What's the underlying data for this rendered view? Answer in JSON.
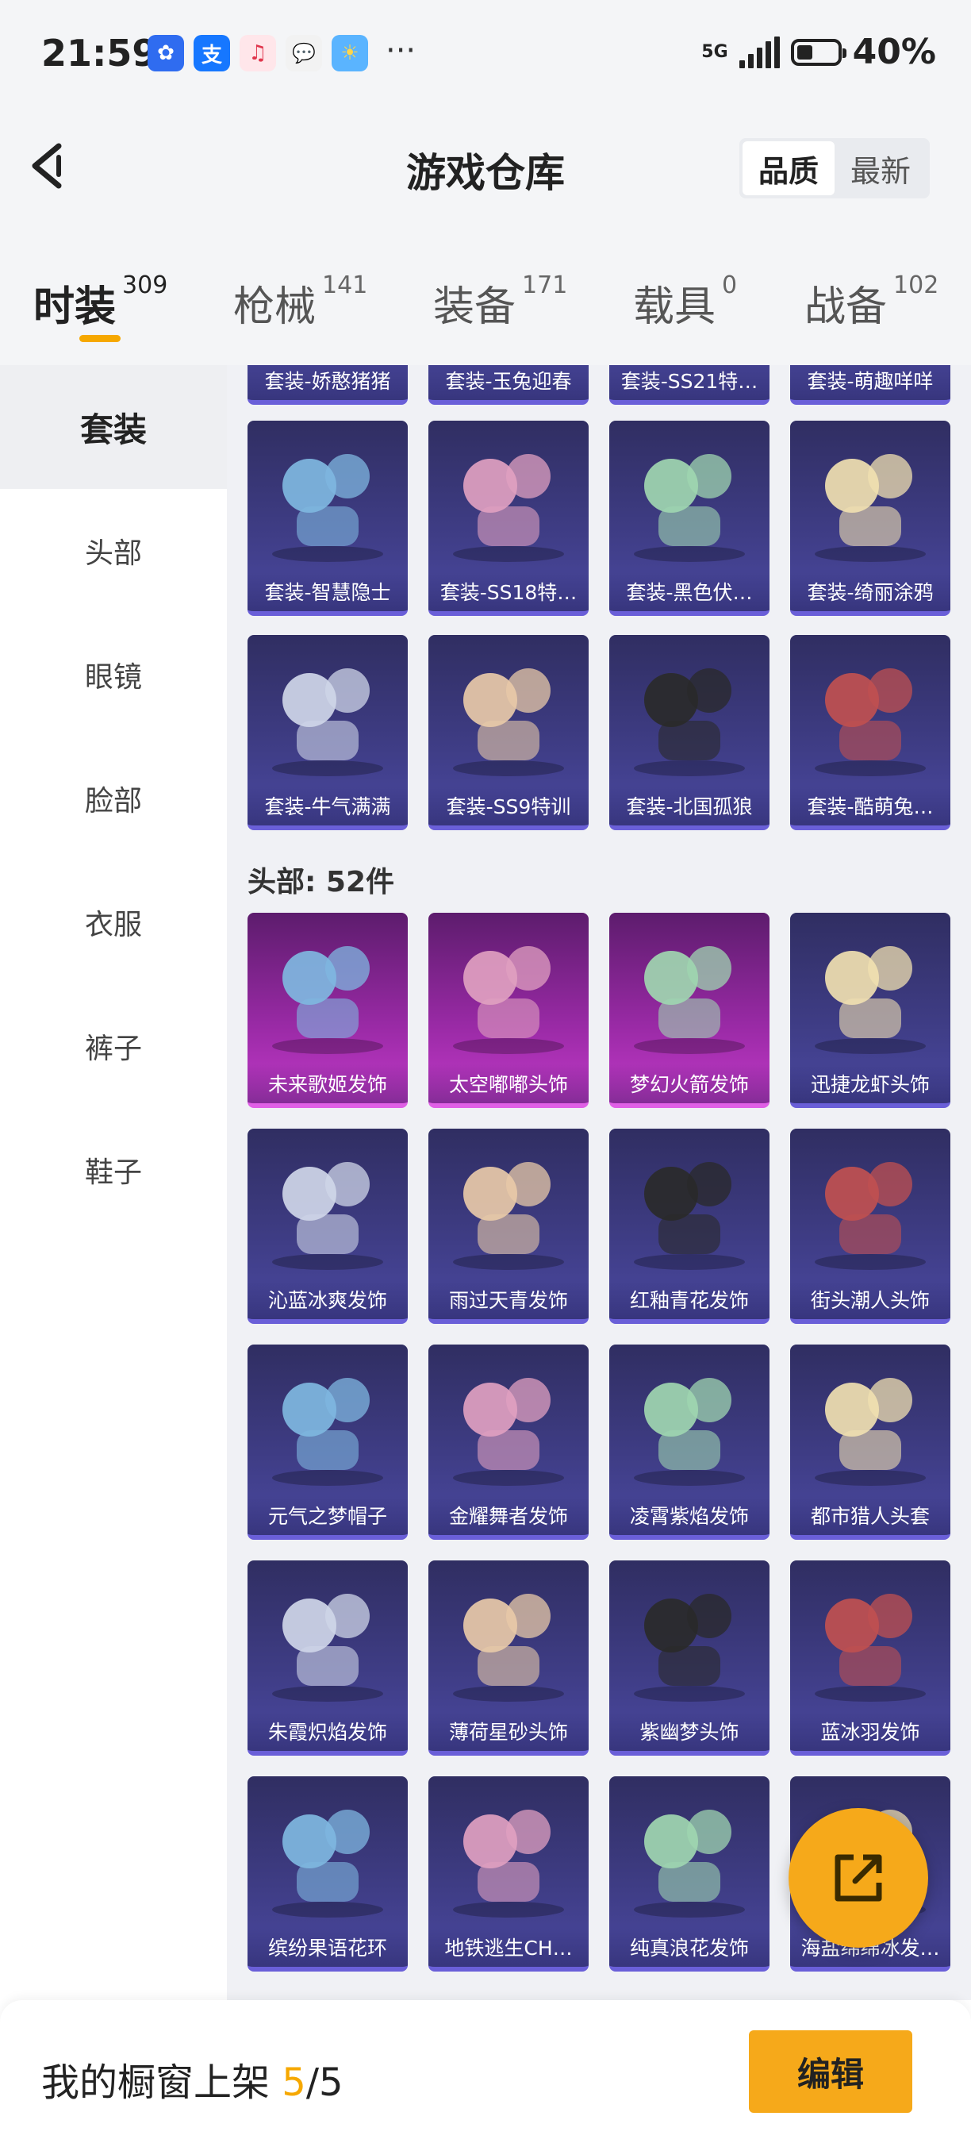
{
  "status_bar": {
    "time": "21:59",
    "apps": [
      {
        "icon": "game-center-icon",
        "color": "#2f6cf0",
        "glyph": "✿"
      },
      {
        "icon": "alipay-icon",
        "color": "#1677ff",
        "glyph": "支"
      },
      {
        "icon": "music-icon",
        "color": "#ffe6ea",
        "glyph": "♫"
      },
      {
        "icon": "wechat-icon",
        "color": "#f2f2f2",
        "glyph": "💬"
      },
      {
        "icon": "weather-icon",
        "color": "#5ab4ff",
        "glyph": "☀"
      }
    ],
    "more": "···",
    "network": "5G",
    "battery_level": 0.4,
    "battery_text": "40%"
  },
  "header": {
    "title": "游戏仓库",
    "sort_options": [
      {
        "label": "品质",
        "active": true
      },
      {
        "label": "最新",
        "active": false
      }
    ]
  },
  "category_tabs": [
    {
      "label": "时装",
      "count": "309",
      "active": true
    },
    {
      "label": "枪械",
      "count": "141",
      "active": false
    },
    {
      "label": "装备",
      "count": "171",
      "active": false
    },
    {
      "label": "载具",
      "count": "0",
      "active": false
    },
    {
      "label": "战备",
      "count": "102",
      "active": false
    }
  ],
  "sidebar": {
    "items": [
      {
        "label": "套装",
        "active": true
      },
      {
        "label": "头部",
        "active": false
      },
      {
        "label": "眼镜",
        "active": false
      },
      {
        "label": "脸部",
        "active": false
      },
      {
        "label": "衣服",
        "active": false
      },
      {
        "label": "裤子",
        "active": false
      },
      {
        "label": "鞋子",
        "active": false
      }
    ]
  },
  "suits": {
    "partial_row": [
      "套装-娇憨猪猪",
      "套装-玉兔迎春",
      "套装-SS21特…",
      "套装-萌趣咩咩"
    ],
    "rows": [
      [
        "套装-智慧隐士",
        "套装-SS18特…",
        "套装-黑色伏…",
        "套装-绮丽涂鸦"
      ],
      [
        "套装-牛气满满",
        "套装-SS9特训",
        "套装-北国孤狼",
        "套装-酷萌兔…"
      ]
    ]
  },
  "head_section": {
    "label": "头部: 52件",
    "rows": [
      [
        "未来歌姬发饰",
        "太空嘟嘟头饰",
        "梦幻火箭发饰",
        "迅捷龙虾头饰"
      ],
      [
        "沁蓝冰爽发饰",
        "雨过天青发饰",
        "红釉青花发饰",
        "街头潮人头饰"
      ],
      [
        "元气之梦帽子",
        "金耀舞者发饰",
        "凌霄紫焰发饰",
        "都市猎人头套"
      ],
      [
        "朱霞炽焰发饰",
        "薄荷星砂头饰",
        "紫幽梦头饰",
        "蓝冰羽发饰"
      ],
      [
        "缤纷果语花环",
        "地铁逃生CH…",
        "纯真浪花发饰",
        "海盐绵绵冰发…"
      ]
    ]
  },
  "footer": {
    "label": "我的橱窗上架",
    "current": "5",
    "separator": "/",
    "total": "5",
    "edit_label": "编辑"
  },
  "colors": {
    "accent": "#f6a91a",
    "card_bg": "#3f3d86",
    "card_pink": "#9a2aa6"
  }
}
